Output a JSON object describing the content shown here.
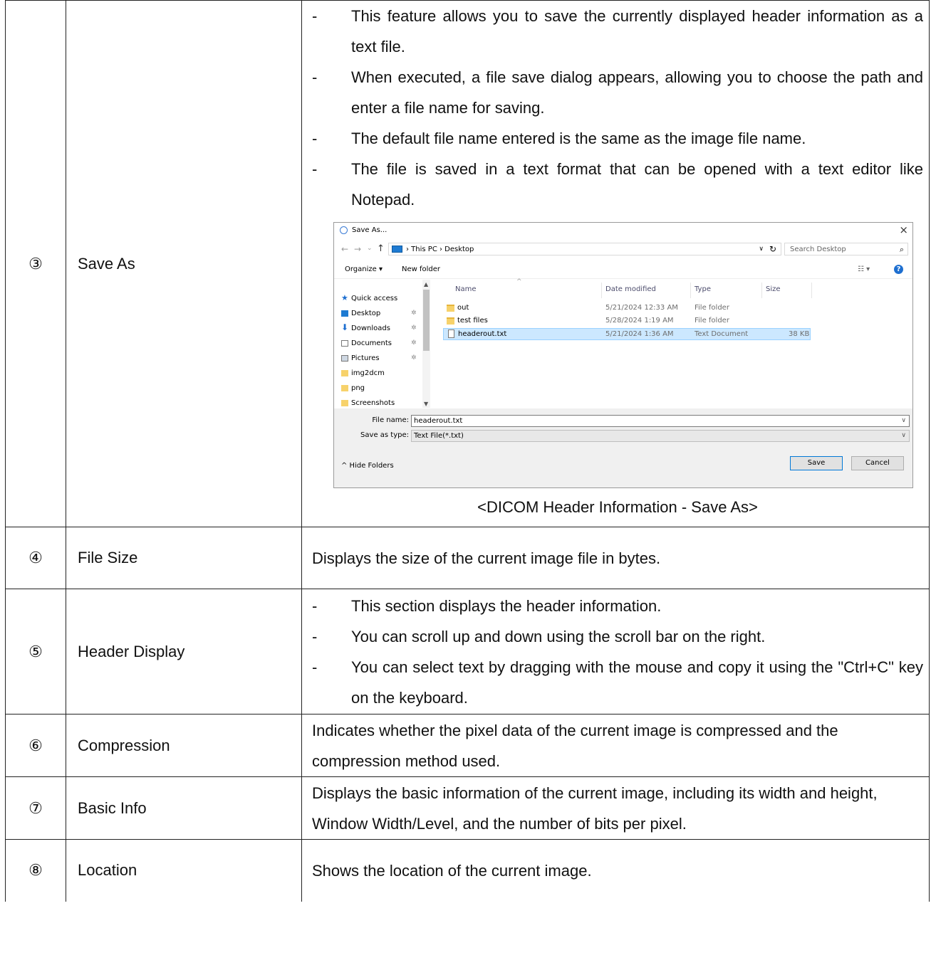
{
  "rows": [
    {
      "num": "③",
      "feature": "Save As",
      "bullets": [
        "This feature allows you to save the currently displayed header information as a text file.",
        "When executed, a file save dialog appears, allowing you to choose the path and enter a file name for saving.",
        "The default file name entered is the same as the image file name.",
        "The file is saved in a text format that can be opened with a text editor like Notepad."
      ],
      "caption": "<DICOM Header Information - Save As>"
    },
    {
      "num": "④",
      "feature": "File Size",
      "text": "Displays the size of the current image file in bytes."
    },
    {
      "num": "⑤",
      "feature": "Header Display",
      "bullets": [
        "This section displays the header information.",
        "You can scroll up and down using the scroll bar on the right.",
        "You can select text by dragging with the mouse and copy it using the \"Ctrl+C\" key on the keyboard."
      ]
    },
    {
      "num": "⑥",
      "feature": "Compression",
      "text": "Indicates whether the pixel data of the current image is compressed and the compression method used."
    },
    {
      "num": "⑦",
      "feature": "Basic Info",
      "text": "Displays the basic information of the current image, including its width and height, Window Width/Level, and the number of bits per pixel."
    },
    {
      "num": "⑧",
      "feature": "Location",
      "text": "Shows the location of the current image."
    }
  ],
  "bullet_dash": "-",
  "dialog": {
    "title": "Save As...",
    "close": "×",
    "nav": {
      "back": "←",
      "forward": "→",
      "dropdown": "⌄",
      "up": "↑"
    },
    "address": "›  This PC  ›  Desktop",
    "address_dropdown": "∨",
    "refresh": "↻",
    "search_placeholder": "Search Desktop",
    "search_icon": "⌕",
    "organize": "Organize ▾",
    "new_folder": "New folder",
    "view_icon": "☷ ▾",
    "help": "?",
    "sidebar": [
      {
        "label": "Quick access",
        "icon": "star-icon",
        "pinned": false
      },
      {
        "label": "Desktop",
        "icon": "desktop-icon",
        "pinned": true
      },
      {
        "label": "Downloads",
        "icon": "download-icon",
        "pinned": true
      },
      {
        "label": "Documents",
        "icon": "documents-icon",
        "pinned": true
      },
      {
        "label": "Pictures",
        "icon": "pictures-icon",
        "pinned": true
      },
      {
        "label": "img2dcm",
        "icon": "folder-icon",
        "pinned": false
      },
      {
        "label": "png",
        "icon": "folder-icon",
        "pinned": false
      },
      {
        "label": "Screenshots",
        "icon": "folder-icon",
        "pinned": false
      }
    ],
    "pin_glyph": "✲",
    "scroll_up": "▲",
    "scroll_down": "▼",
    "sort_arrow": "^",
    "columns": [
      "Name",
      "Date modified",
      "Type",
      "Size"
    ],
    "files": [
      {
        "name": "out",
        "date": "5/21/2024 12:33 AM",
        "type": "File folder",
        "size": "",
        "kind": "folder",
        "selected": false
      },
      {
        "name": "test files",
        "date": "5/28/2024 1:19 AM",
        "type": "File folder",
        "size": "",
        "kind": "folder",
        "selected": false
      },
      {
        "name": "headerout.txt",
        "date": "5/21/2024 1:36 AM",
        "type": "Text Document",
        "size": "38 KB",
        "kind": "file",
        "selected": true
      }
    ],
    "file_name_label": "File name:",
    "file_name_value": "headerout.txt",
    "save_type_label": "Save as type:",
    "save_type_value": "Text File(*.txt)",
    "field_dropdown": "∨",
    "hide_folders": "^  Hide Folders",
    "save_button": "Save",
    "cancel_button": "Cancel"
  },
  "colors": {
    "accent": "#0078d7",
    "selection": "#cce8ff",
    "folder": "#f7d26b"
  }
}
